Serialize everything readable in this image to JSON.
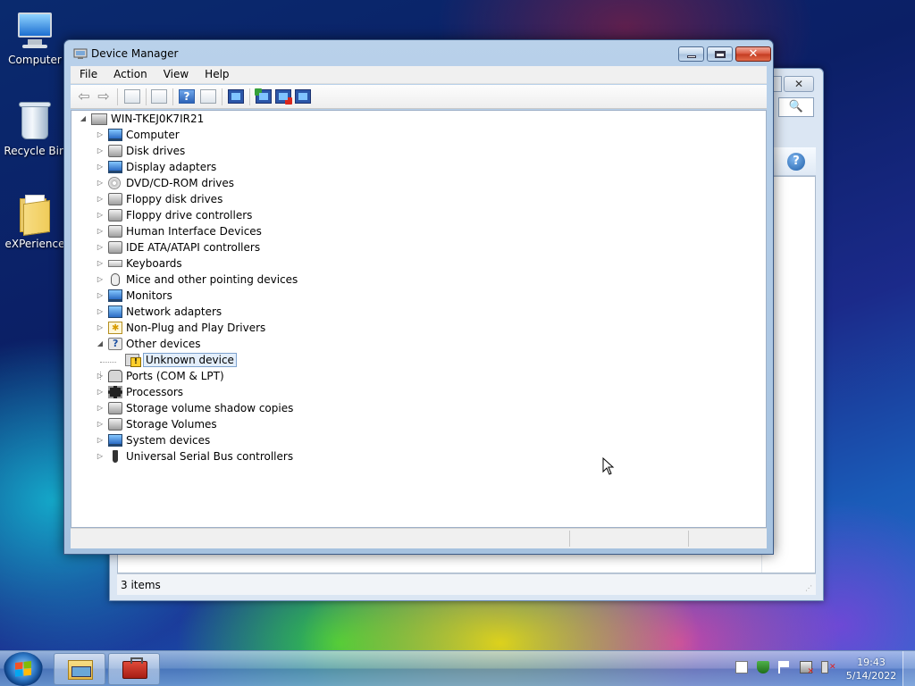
{
  "desktop": {
    "icons": [
      {
        "label": "Computer",
        "icon": "computer-icon"
      },
      {
        "label": "Recycle Bin",
        "icon": "recycle-bin-icon"
      },
      {
        "label": "eXPerience",
        "icon": "folder-icon"
      }
    ]
  },
  "background_window": {
    "status_text": "3 items",
    "close_glyph": "✕",
    "search_glyph": "🔍",
    "help_glyph": "?"
  },
  "device_manager": {
    "title": "Device Manager",
    "close_glyph": "✕",
    "menu": [
      "File",
      "Action",
      "View",
      "Help"
    ],
    "toolbar": {
      "back_glyph": "⇦",
      "forward_glyph": "⇨",
      "help_glyph": "?"
    },
    "tree": {
      "root": "WIN-TKEJ0K7IR21",
      "root_expander": "◢",
      "collapsed_glyph": "▷",
      "expanded_glyph": "◢",
      "categories": [
        {
          "label": "Computer",
          "icon": "computer-icon"
        },
        {
          "label": "Disk drives",
          "icon": "disk-drive-icon"
        },
        {
          "label": "Display adapters",
          "icon": "display-adapter-icon"
        },
        {
          "label": "DVD/CD-ROM drives",
          "icon": "dvd-drive-icon"
        },
        {
          "label": "Floppy disk drives",
          "icon": "floppy-disk-icon"
        },
        {
          "label": "Floppy drive controllers",
          "icon": "floppy-controller-icon"
        },
        {
          "label": "Human Interface Devices",
          "icon": "hid-icon"
        },
        {
          "label": "IDE ATA/ATAPI controllers",
          "icon": "ide-controller-icon"
        },
        {
          "label": "Keyboards",
          "icon": "keyboard-icon"
        },
        {
          "label": "Mice and other pointing devices",
          "icon": "mouse-icon"
        },
        {
          "label": "Monitors",
          "icon": "monitor-icon"
        },
        {
          "label": "Network adapters",
          "icon": "network-adapter-icon"
        },
        {
          "label": "Non-Plug and Play Drivers",
          "icon": "non-pnp-driver-icon"
        },
        {
          "label": "Other devices",
          "icon": "other-devices-icon",
          "expanded": true
        },
        {
          "label": "Ports (COM & LPT)",
          "icon": "port-icon"
        },
        {
          "label": "Processors",
          "icon": "processor-icon"
        },
        {
          "label": "Storage volume shadow copies",
          "icon": "shadow-copy-icon"
        },
        {
          "label": "Storage Volumes",
          "icon": "storage-volume-icon"
        },
        {
          "label": "System devices",
          "icon": "system-devices-icon"
        },
        {
          "label": "Universal Serial Bus controllers",
          "icon": "usb-controller-icon"
        }
      ],
      "child": {
        "label": "Unknown device",
        "icon": "unknown-device-warning-icon",
        "selected": true
      }
    }
  },
  "taskbar": {
    "time": "19:43",
    "date": "5/14/2022"
  }
}
